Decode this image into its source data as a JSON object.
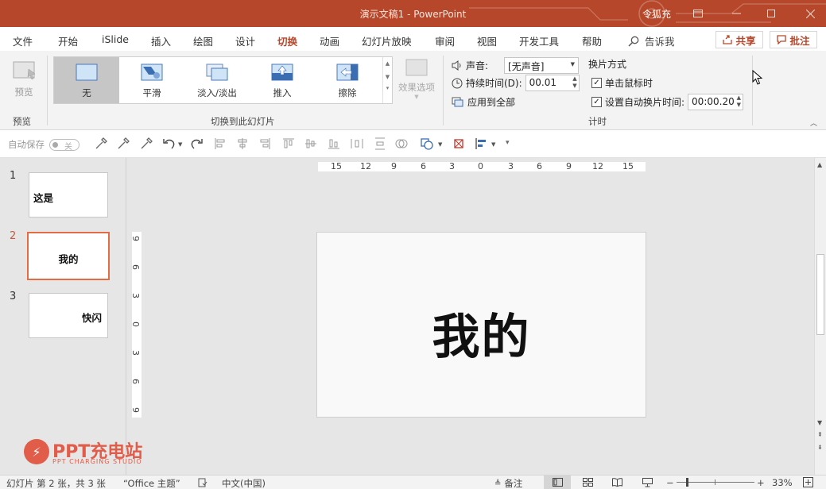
{
  "titlebar": {
    "title": "演示文稿1  -  PowerPoint",
    "user": "令狐充"
  },
  "menu": {
    "tabs": [
      "文件",
      "开始",
      "iSlide",
      "插入",
      "绘图",
      "设计",
      "切换",
      "动画",
      "幻灯片放映",
      "审阅",
      "视图",
      "开发工具",
      "帮助"
    ],
    "active": "切换",
    "tell_me": "告诉我",
    "share": "共享",
    "comment": "批注"
  },
  "ribbon": {
    "preview": {
      "label": "预览",
      "group": "预览"
    },
    "transitions": {
      "items": [
        "无",
        "平滑",
        "淡入/淡出",
        "推入",
        "擦除"
      ],
      "selected": "无",
      "group": "切换到此幻灯片"
    },
    "effect_options": "效果选项",
    "timing": {
      "sound_label": "声音:",
      "sound_value": "[无声音]",
      "duration_label": "持续时间(D):",
      "duration_value": "00.01",
      "apply_all": "应用到全部",
      "advance_heading": "换片方式",
      "on_click": "单击鼠标时",
      "on_click_checked": true,
      "auto_after": "设置自动换片时间:",
      "auto_after_checked": true,
      "auto_after_value": "00:00.20",
      "group": "计时"
    }
  },
  "qtb": {
    "autosave_label": "自动保存",
    "autosave_state": "关"
  },
  "slides": [
    {
      "num": "1",
      "text": "这是"
    },
    {
      "num": "2",
      "text": "我的"
    },
    {
      "num": "3",
      "text": "快闪"
    }
  ],
  "active_slide": 2,
  "ruler": {
    "h": [
      "15",
      "12",
      "9",
      "6",
      "3",
      "0",
      "3",
      "6",
      "9",
      "12",
      "15"
    ],
    "v": [
      "9",
      "6",
      "3",
      "0",
      "3",
      "6",
      "9"
    ]
  },
  "slide": {
    "title": "我的"
  },
  "status": {
    "slide_info": "幻灯片 第 2 张，共 3 张",
    "theme": "“Office 主题”",
    "language": "中文(中国)",
    "notes": "备注",
    "zoom": "33%"
  },
  "watermark": {
    "brand": "PPT充电站",
    "sub": "PPT CHARGING STUDIO"
  },
  "colors": {
    "accent": "#b7472a",
    "active_thumb": "#e46c45"
  }
}
